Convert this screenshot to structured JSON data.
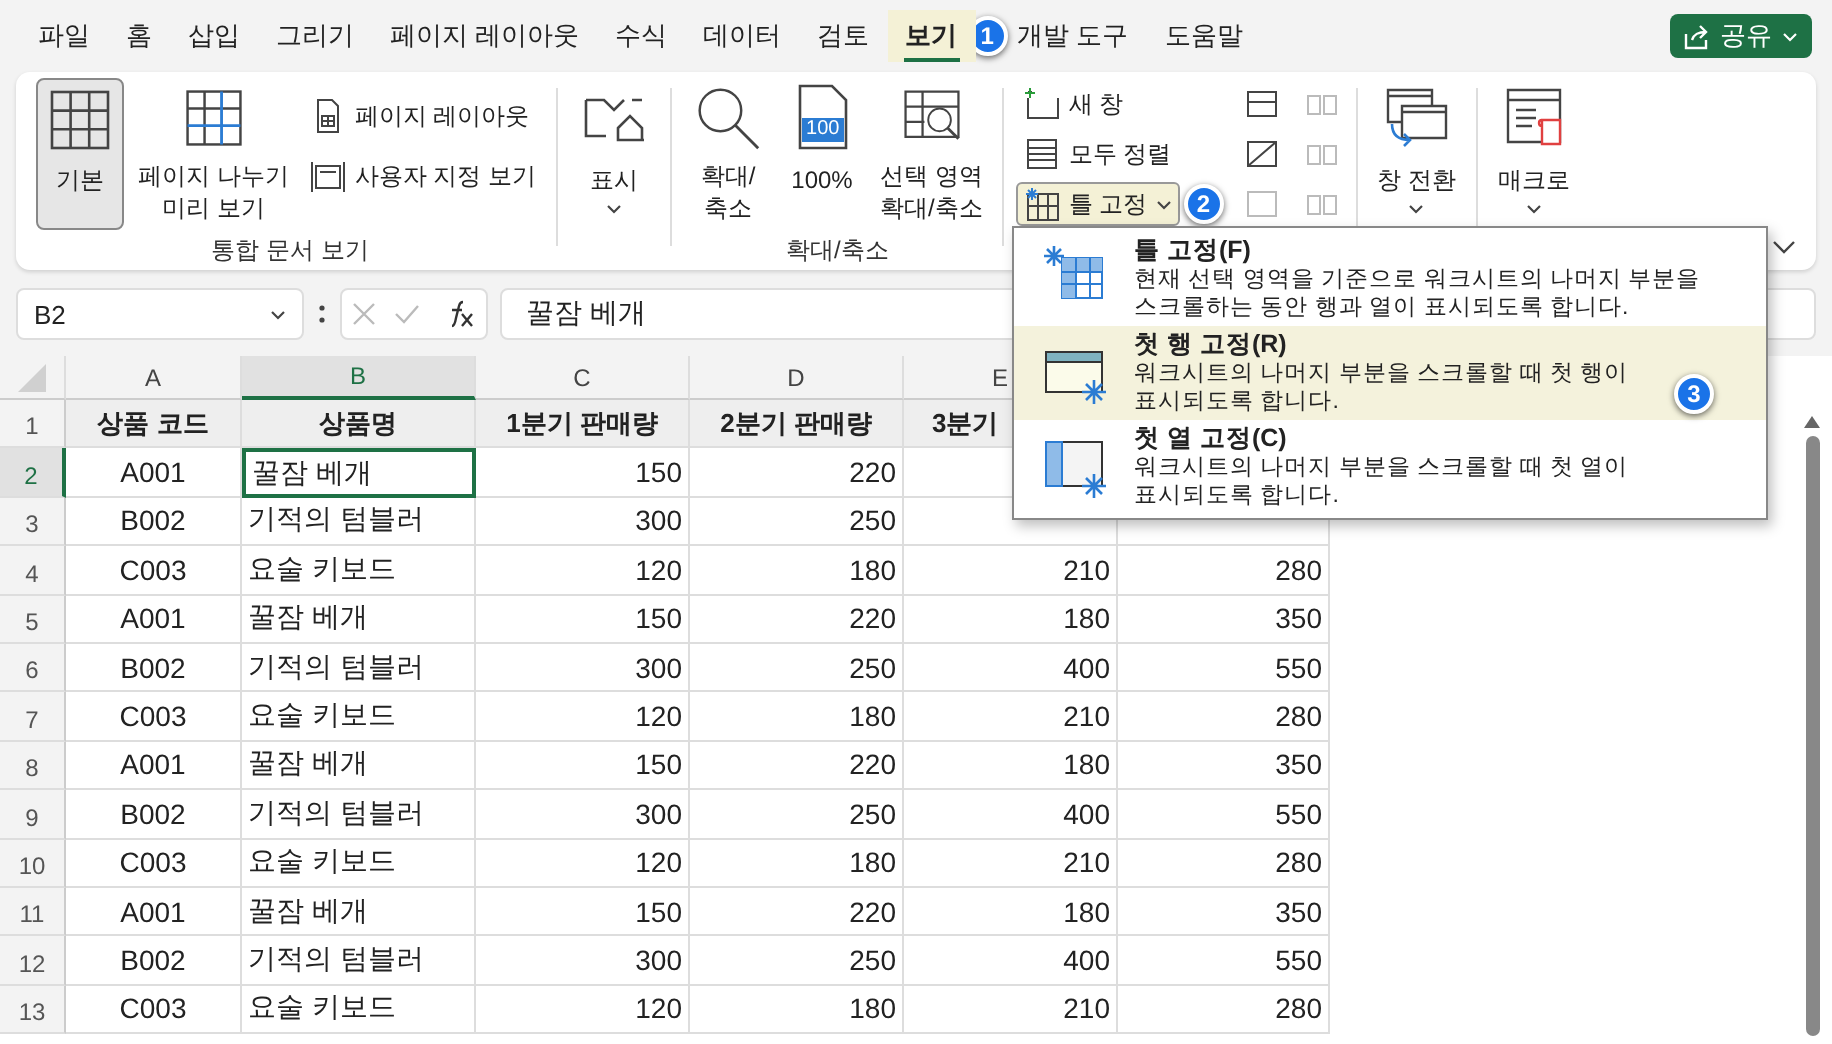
{
  "menu_tabs": [
    {
      "label": "파일",
      "selected": false
    },
    {
      "label": "홈",
      "selected": false
    },
    {
      "label": "삽입",
      "selected": false
    },
    {
      "label": "그리기",
      "selected": false
    },
    {
      "label": "페이지 레이아웃",
      "selected": false
    },
    {
      "label": "수식",
      "selected": false
    },
    {
      "label": "데이터",
      "selected": false
    },
    {
      "label": "검토",
      "selected": false
    },
    {
      "label": "보기",
      "selected": true
    },
    {
      "label": "개발 도구",
      "selected": false
    },
    {
      "label": "도움말",
      "selected": false
    }
  ],
  "share_button": {
    "label": "공유"
  },
  "callouts": [
    "1",
    "2",
    "3"
  ],
  "ribbon": {
    "groups": [
      {
        "label": "통합 문서 보기",
        "buttons": [
          {
            "label": "기본",
            "selected": true
          },
          {
            "label": "페이지 나누기\n미리 보기",
            "selected": false
          },
          {
            "label": "페이지 레이아웃",
            "selected": false
          },
          {
            "label": "사용자 지정 보기",
            "selected": false
          }
        ]
      },
      {
        "buttons": [
          {
            "label": "표시"
          }
        ]
      },
      {
        "label": "확대/축소",
        "buttons": [
          {
            "label": "확대/\n축소"
          },
          {
            "label": "100%",
            "icon_text": "100"
          },
          {
            "label": "선택 영역\n확대/축소"
          }
        ]
      },
      {
        "buttons": [
          {
            "label": "새 창"
          },
          {
            "label": "모두 정렬"
          },
          {
            "label": "틀 고정",
            "expanded": true
          }
        ]
      },
      {
        "buttons": [
          {
            "label": "창 전환"
          }
        ]
      },
      {
        "buttons": [
          {
            "label": "매크로"
          }
        ]
      }
    ]
  },
  "freeze_menu": {
    "items": [
      {
        "title": "틀 고정(F)",
        "description": "현재 선택 영역을 기준으로 워크시트의 나머지 부분을\n스크롤하는 동안 행과 열이 표시되도록 합니다.",
        "selected": false
      },
      {
        "title": "첫 행 고정(R)",
        "description": "워크시트의 나머지 부분을 스크롤할 때 첫 행이\n표시되도록 합니다.",
        "selected": true
      },
      {
        "title": "첫 열 고정(C)",
        "description": "워크시트의 나머지 부분을 스크롤할 때 첫 열이\n표시되도록 합니다.",
        "selected": false
      }
    ]
  },
  "formula_bar": {
    "name_box": "B2",
    "value": "꿀잠 베개"
  },
  "sheet": {
    "columns": [
      {
        "label": "A",
        "selected": false
      },
      {
        "label": "B",
        "selected": true
      },
      {
        "label": "C",
        "selected": false
      },
      {
        "label": "D",
        "selected": false
      },
      {
        "label": "E",
        "selected": false
      }
    ],
    "rows": [
      {
        "number": "1",
        "kind": "header",
        "selected": false,
        "cells": [
          "상품 코드",
          "상품명",
          "1분기 판매량",
          "2분기 판매량",
          "3분기"
        ]
      },
      {
        "number": "2",
        "kind": "data",
        "selected": true,
        "cells": [
          "A001",
          "꿀잠 베개",
          "150",
          "220"
        ]
      },
      {
        "number": "3",
        "kind": "data",
        "selected": false,
        "cells": [
          "B002",
          "기적의 텀블러",
          "300",
          "250"
        ]
      },
      {
        "number": "4",
        "kind": "data",
        "selected": false,
        "cells": [
          "C003",
          "요술 키보드",
          "120",
          "180",
          "210",
          "280"
        ]
      },
      {
        "number": "5",
        "kind": "data",
        "selected": false,
        "cells": [
          "A001",
          "꿀잠 베개",
          "150",
          "220",
          "180",
          "350"
        ]
      },
      {
        "number": "6",
        "kind": "data",
        "selected": false,
        "cells": [
          "B002",
          "기적의 텀블러",
          "300",
          "250",
          "400",
          "550"
        ]
      },
      {
        "number": "7",
        "kind": "data",
        "selected": false,
        "cells": [
          "C003",
          "요술 키보드",
          "120",
          "180",
          "210",
          "280"
        ]
      },
      {
        "number": "8",
        "kind": "data",
        "selected": false,
        "cells": [
          "A001",
          "꿀잠 베개",
          "150",
          "220",
          "180",
          "350"
        ]
      },
      {
        "number": "9",
        "kind": "data",
        "selected": false,
        "cells": [
          "B002",
          "기적의 텀블러",
          "300",
          "250",
          "400",
          "550"
        ]
      },
      {
        "number": "10",
        "kind": "data",
        "selected": false,
        "cells": [
          "C003",
          "요술 키보드",
          "120",
          "180",
          "210",
          "280"
        ]
      },
      {
        "number": "11",
        "kind": "data",
        "selected": false,
        "cells": [
          "A001",
          "꿀잠 베개",
          "150",
          "220",
          "180",
          "350"
        ]
      },
      {
        "number": "12",
        "kind": "data",
        "selected": false,
        "cells": [
          "B002",
          "기적의 텀블러",
          "300",
          "250",
          "400",
          "550"
        ]
      },
      {
        "number": "13",
        "kind": "data",
        "selected": false,
        "cells": [
          "C003",
          "요술 키보드",
          "120",
          "180",
          "210",
          "280"
        ]
      }
    ]
  }
}
